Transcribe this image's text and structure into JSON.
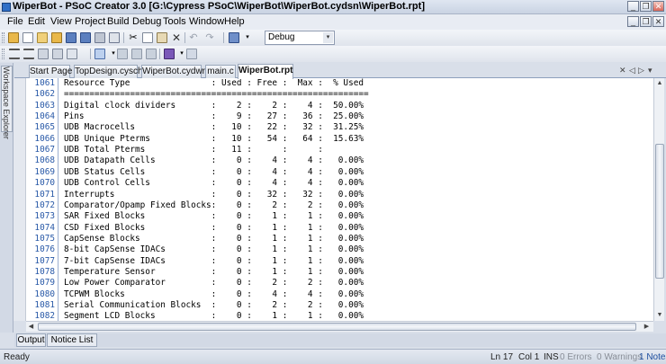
{
  "window": {
    "title": "WiperBot - PSoC Creator 3.0  [G:\\Cypress PSoC\\WiperBot\\WiperBot.cydsn\\WiperBot.rpt]",
    "controls": [
      "_",
      "❐",
      "✕"
    ],
    "doc_controls": [
      "_",
      "❐",
      "✕"
    ]
  },
  "menu": [
    "File",
    "Edit",
    "View",
    "Project",
    "Build",
    "Debug",
    "Tools",
    "Window",
    "Help"
  ],
  "toolbar": {
    "build_config": "Debug"
  },
  "side_panel": {
    "label": "Workspace Explorer"
  },
  "tabs": [
    {
      "label": "Start Page"
    },
    {
      "label": "TopDesign.cysch"
    },
    {
      "label": "WiperBot.cydwr"
    },
    {
      "label": "main.c"
    },
    {
      "label": "WiperBot.rpt"
    }
  ],
  "tab_controls": [
    "✕",
    "◁",
    "▷",
    "▾"
  ],
  "report": {
    "lines": [
      {
        "num": "1061",
        "text": "Resource Type                : Used : Free :  Max :  % Used"
      },
      {
        "num": "1062",
        "text": "============================================================"
      },
      {
        "num": "1063",
        "text": "Digital clock dividers       :    2 :    2 :    4 :  50.00%"
      },
      {
        "num": "1064",
        "text": "Pins                         :    9 :   27 :   36 :  25.00%"
      },
      {
        "num": "1065",
        "text": "UDB Macrocells               :   10 :   22 :   32 :  31.25%"
      },
      {
        "num": "1066",
        "text": "UDB Unique Pterms            :   10 :   54 :   64 :  15.63%"
      },
      {
        "num": "1067",
        "text": "UDB Total Pterms             :   11 :      :      :"
      },
      {
        "num": "1068",
        "text": "UDB Datapath Cells           :    0 :    4 :    4 :   0.00%"
      },
      {
        "num": "1069",
        "text": "UDB Status Cells             :    0 :    4 :    4 :   0.00%"
      },
      {
        "num": "1070",
        "text": "UDB Control Cells            :    0 :    4 :    4 :   0.00%"
      },
      {
        "num": "1071",
        "text": "Interrupts                   :    0 :   32 :   32 :   0.00%"
      },
      {
        "num": "1072",
        "text": "Comparator/Opamp Fixed Blocks:    0 :    2 :    2 :   0.00%"
      },
      {
        "num": "1073",
        "text": "SAR Fixed Blocks             :    0 :    1 :    1 :   0.00%"
      },
      {
        "num": "1074",
        "text": "CSD Fixed Blocks             :    0 :    1 :    1 :   0.00%"
      },
      {
        "num": "1075",
        "text": "CapSense Blocks              :    0 :    1 :    1 :   0.00%"
      },
      {
        "num": "1076",
        "text": "8-bit CapSense IDACs         :    0 :    1 :    1 :   0.00%"
      },
      {
        "num": "1077",
        "text": "7-bit CapSense IDACs         :    0 :    1 :    1 :   0.00%"
      },
      {
        "num": "1078",
        "text": "Temperature Sensor           :    0 :    1 :    1 :   0.00%"
      },
      {
        "num": "1079",
        "text": "Low Power Comparator         :    0 :    2 :    2 :   0.00%"
      },
      {
        "num": "1080",
        "text": "TCPWM Blocks                 :    0 :    4 :    4 :   0.00%"
      },
      {
        "num": "1081",
        "text": "Serial Communication Blocks  :    0 :    2 :    2 :   0.00%"
      },
      {
        "num": "1082",
        "text": "Segment LCD Blocks           :    0 :    1 :    1 :   0.00%"
      }
    ]
  },
  "bottom_tabs": [
    "Output",
    "Notice List"
  ],
  "status": {
    "ready": "Ready",
    "ln": "Ln 17",
    "col": "Col 1",
    "ins": "INS",
    "errors": "0 Errors",
    "warnings": "0 Warnings",
    "notes": "1 Notes"
  },
  "colors": {
    "line_numbers": "#2a5aa8",
    "notes_link": "#1f4fa0"
  }
}
